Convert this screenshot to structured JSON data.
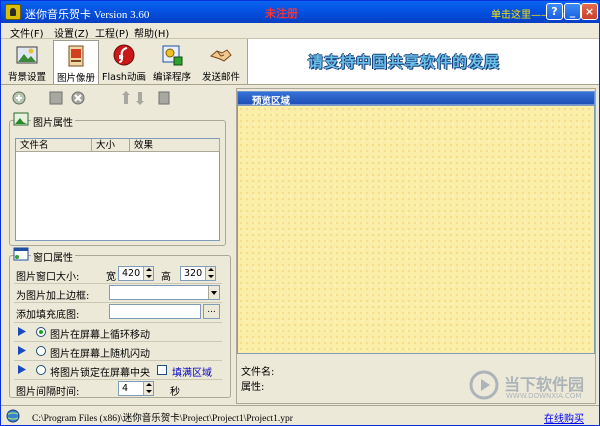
{
  "window": {
    "title": "迷你音乐贺卡 Version 3.60",
    "status_badge": "未注册",
    "promo_link": "单击这里——>>",
    "buttons": {
      "help": "?",
      "minimize": "_",
      "close": "×"
    }
  },
  "menu": [
    {
      "label": "文件(F)"
    },
    {
      "label": "设置(Z)"
    },
    {
      "label": "工程(P)"
    },
    {
      "label": "帮助(H)"
    }
  ],
  "toolbar": [
    {
      "label": "背景设置",
      "icon": "background-icon"
    },
    {
      "label": "图片像册",
      "icon": "photo-album-icon",
      "active": true
    },
    {
      "label": "Flash动画",
      "icon": "flash-icon"
    },
    {
      "label": "编译程序",
      "icon": "compile-icon"
    },
    {
      "label": "发送邮件",
      "icon": "handshake-icon"
    }
  ],
  "banner": {
    "text": "请支持中国共享软件的发展"
  },
  "picture_props": {
    "title": "图片属性",
    "columns": [
      "文件名",
      "大小",
      "效果"
    ]
  },
  "window_props": {
    "title": "窗口属性",
    "size_label": "图片窗口大小:",
    "width_label": "宽",
    "width_value": "420",
    "height_label": "高",
    "height_value": "320",
    "border_label": "为图片加上边框:",
    "border_value": "",
    "fill_label": "添加填充底图:",
    "fill_value": "",
    "browse_label": "...",
    "mode_loop": "图片在屏幕上循环移动",
    "mode_random": "图片在屏幕上随机闪动",
    "mode_center": "将图片锁定在屏幕中央",
    "fill_area_label": "填满区域",
    "interval_label": "图片间隔时间:",
    "interval_value": "4",
    "interval_unit": "秒"
  },
  "preview": {
    "title": "预览区域",
    "filename_label": "文件名:",
    "props_label": "属性:"
  },
  "status": {
    "path": "C:\\Program Files (x86)\\迷你音乐贺卡\\Project\\Project1\\Project1.ypr",
    "buy_link": "在线购买"
  },
  "watermark": {
    "text": "当下软件园",
    "sub": "WWW.DOWNXIA.COM"
  },
  "colors": {
    "titlebar": "#0554e3",
    "unregistered": "#ff3030",
    "promo": "#ffe400",
    "preview_bg": "#fbeea8",
    "banner_text": "#6ac2e8",
    "link": "#0000ff"
  }
}
